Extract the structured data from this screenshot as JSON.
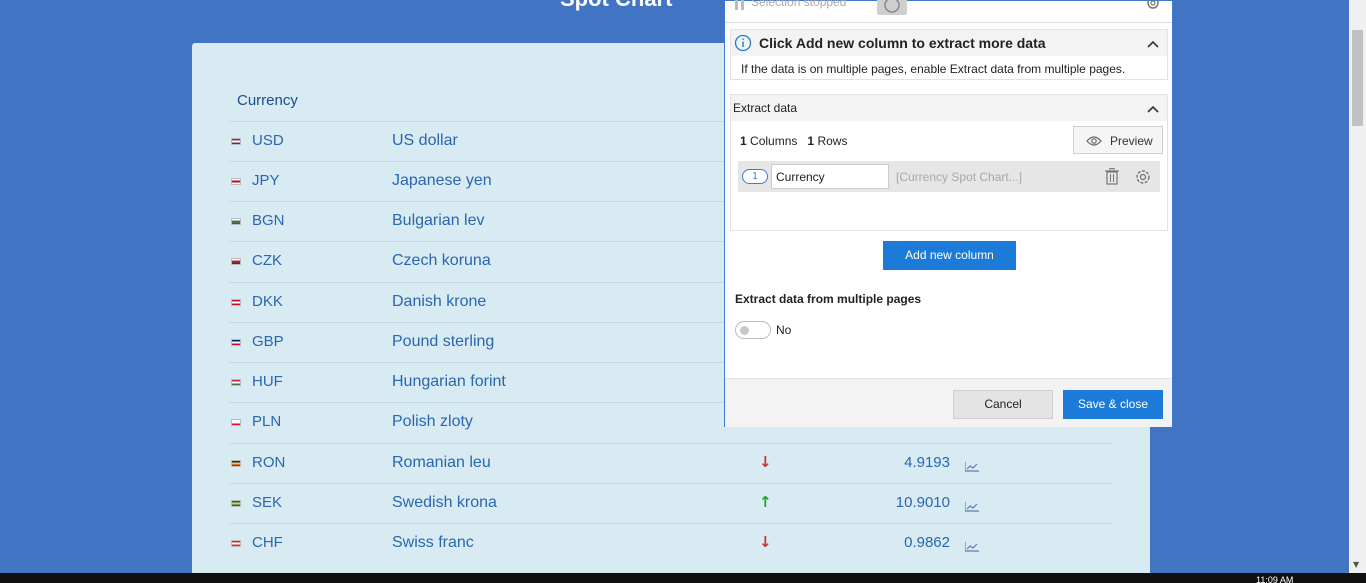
{
  "page": {
    "heading": "Spot Chart",
    "column_header": "Currency"
  },
  "rates": [
    {
      "code": "USD",
      "name": "US dollar",
      "flag_colors": [
        "#b22234",
        "#ffffff",
        "#3c3b6e"
      ],
      "trend": "",
      "rate": ""
    },
    {
      "code": "JPY",
      "name": "Japanese yen",
      "flag_colors": [
        "#ffffff",
        "#bc002d",
        "#ffffff"
      ],
      "trend": "",
      "rate": ""
    },
    {
      "code": "BGN",
      "name": "Bulgarian lev",
      "flag_colors": [
        "#ffffff",
        "#00966e",
        "#d62612"
      ],
      "trend": "",
      "rate": ""
    },
    {
      "code": "CZK",
      "name": "Czech koruna",
      "flag_colors": [
        "#ffffff",
        "#d7141a",
        "#11457e"
      ],
      "trend": "",
      "rate": ""
    },
    {
      "code": "DKK",
      "name": "Danish krone",
      "flag_colors": [
        "#c8102e",
        "#ffffff",
        "#c8102e"
      ],
      "trend": "",
      "rate": ""
    },
    {
      "code": "GBP",
      "name": "Pound sterling",
      "flag_colors": [
        "#012169",
        "#ffffff",
        "#c8102e"
      ],
      "trend": "",
      "rate": ""
    },
    {
      "code": "HUF",
      "name": "Hungarian forint",
      "flag_colors": [
        "#ce2939",
        "#ffffff",
        "#477050"
      ],
      "trend": "",
      "rate": ""
    },
    {
      "code": "PLN",
      "name": "Polish zloty",
      "flag_colors": [
        "#ffffff",
        "#ffffff",
        "#dc143c"
      ],
      "trend": "",
      "rate": ""
    },
    {
      "code": "RON",
      "name": "Romanian leu",
      "flag_colors": [
        "#002b7f",
        "#fcd116",
        "#ce1126"
      ],
      "trend": "down",
      "rate": "4.9193"
    },
    {
      "code": "SEK",
      "name": "Swedish krona",
      "flag_colors": [
        "#006aa7",
        "#fecc00",
        "#006aa7"
      ],
      "trend": "up",
      "rate": "10.9010"
    },
    {
      "code": "CHF",
      "name": "Swiss franc",
      "flag_colors": [
        "#d52b1e",
        "#ffffff",
        "#d52b1e"
      ],
      "trend": "down",
      "rate": "0.9862"
    }
  ],
  "panel": {
    "selection_status": "Selection stopped",
    "info_title": "Click Add new column to extract more data",
    "info_text": "If the data is on multiple pages, enable Extract data from multiple pages.",
    "extract_title": "Extract data",
    "columns_count": "1",
    "columns_label": "Columns",
    "rows_count": "1",
    "rows_label": "Rows",
    "preview_label": "Preview",
    "column": {
      "index": "1",
      "name_value": "Currency",
      "source": "[Currency Spot Chart...]"
    },
    "add_column_label": "Add new column",
    "multi_pages_label": "Extract data from multiple pages",
    "multi_pages_state": "No",
    "cancel_label": "Cancel",
    "save_label": "Save & close",
    "accent_color": "#1c7ad8"
  },
  "taskbar": {
    "clock": "11:09 AM"
  },
  "icons": [
    "pause-icon",
    "eye-icon",
    "gear-icon",
    "info-icon",
    "chevron-up-icon",
    "trash-icon",
    "line-chart-icon",
    "arrow-up-icon",
    "arrow-down-icon"
  ]
}
